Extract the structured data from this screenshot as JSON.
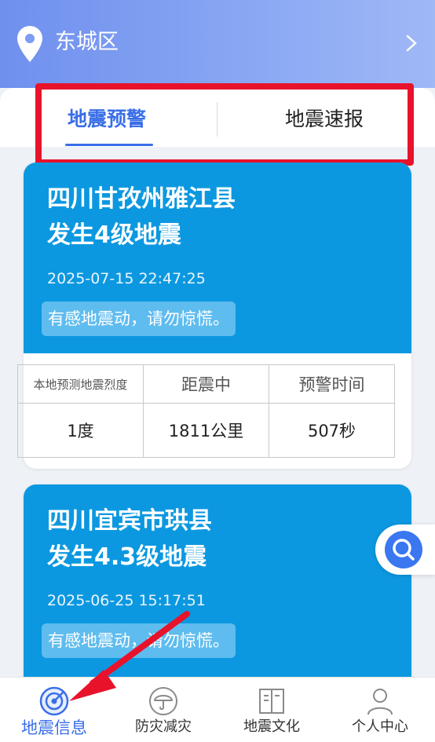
{
  "header": {
    "location": "东城区",
    "icons": {
      "pin": "location-pin-icon",
      "chevron": "chevron-right-icon"
    }
  },
  "tabs": [
    {
      "label": "地震预警",
      "active": true
    },
    {
      "label": "地震速报",
      "active": false
    }
  ],
  "cards": [
    {
      "title_line1": "四川甘孜州雅江县",
      "title_line2": "发生4级地震",
      "time": "2025-07-15 22:47:25",
      "note": "有感地震动，请勿惊慌。",
      "metrics": {
        "headers": [
          "本地预测地震烈度",
          "距震中",
          "预警时间"
        ],
        "values": [
          "1度",
          "1811公里",
          "507秒"
        ]
      }
    },
    {
      "title_line1": "四川宜宾市珙县",
      "title_line2": "发生4.3级地震",
      "time": "2025-06-25 15:17:51",
      "note": "有感地震动，请勿惊慌。"
    }
  ],
  "float": {
    "icon": "search-icon"
  },
  "bottom_nav": [
    {
      "label": "地震信息",
      "icon": "radar-icon",
      "active": true
    },
    {
      "label": "防灾减灾",
      "icon": "umbrella-icon",
      "active": false
    },
    {
      "label": "地震文化",
      "icon": "book-icon",
      "active": false
    },
    {
      "label": "个人中心",
      "icon": "person-icon",
      "active": false
    }
  ],
  "colors": {
    "header_start": "#6f90ee",
    "accent": "#3a6ee8",
    "card_blue": "#0c98e0",
    "highlight_red": "#e8132b"
  }
}
